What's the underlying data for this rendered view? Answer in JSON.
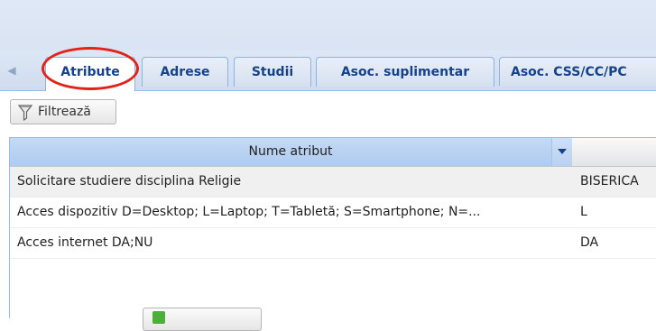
{
  "tabs": [
    {
      "label": "Atribute",
      "active": true
    },
    {
      "label": "Adrese",
      "active": false
    },
    {
      "label": "Studii",
      "active": false
    },
    {
      "label": "Asoc. suplimentar",
      "active": false
    },
    {
      "label": "Asoc. CSS/CC/PC",
      "active": false
    }
  ],
  "toolbar": {
    "filter_label": "Filtrează"
  },
  "grid": {
    "columns": [
      "Nume atribut",
      ""
    ],
    "rows": [
      {
        "name": "Solicitare studiere disciplina Religie",
        "value": "BISERICA"
      },
      {
        "name": "Acces dispozitiv D=Desktop; L=Laptop; T=Tabletă; S=Smartphone; N=...",
        "value": "L"
      },
      {
        "name": "Acces internet DA;NU",
        "value": "DA"
      }
    ]
  },
  "colors": {
    "tab_text": "#15428b",
    "highlight": "#e2231a",
    "header_selected": "#aecbf0"
  },
  "icons": {
    "scroll_left": "arrow-left-icon",
    "filter": "funnel-icon",
    "sort": "chevron-down-icon"
  }
}
